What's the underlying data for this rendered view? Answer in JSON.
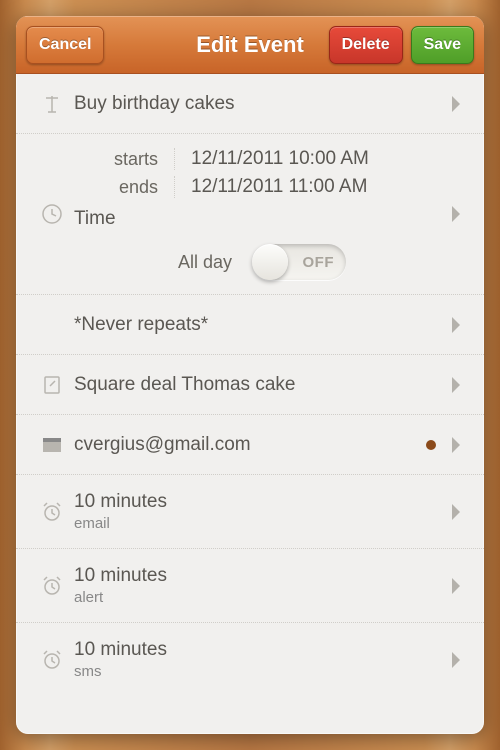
{
  "header": {
    "cancel": "Cancel",
    "title": "Edit Event",
    "delete": "Delete",
    "save": "Save"
  },
  "event": {
    "title": "Buy birthday cakes"
  },
  "time": {
    "starts_label": "starts",
    "starts_value": "12/11/2011 10:00 AM",
    "ends_label": "ends",
    "ends_value": "12/11/2011 11:00 AM",
    "section_label": "Time",
    "allday_label": "All day",
    "allday_state": "OFF"
  },
  "repeat": {
    "value": "*Never repeats*"
  },
  "location": {
    "value": "Square deal Thomas cake"
  },
  "calendar": {
    "value": "cvergius@gmail.com"
  },
  "reminders": [
    {
      "time": "10 minutes",
      "method": "email"
    },
    {
      "time": "10 minutes",
      "method": "alert"
    },
    {
      "time": "10 minutes",
      "method": "sms"
    }
  ]
}
